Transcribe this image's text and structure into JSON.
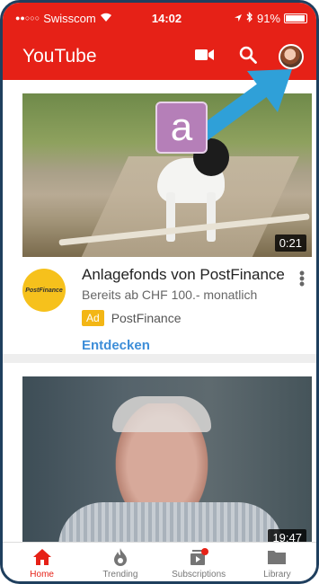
{
  "status_bar": {
    "carrier": "Swisscom",
    "time": "14:02",
    "battery": "91%"
  },
  "app_bar": {
    "title": "YouTube",
    "actions": [
      {
        "name": "camera-icon"
      },
      {
        "name": "search-icon"
      },
      {
        "name": "avatar"
      }
    ]
  },
  "overlay": {
    "badge_letter": "a"
  },
  "feed": {
    "ad_card": {
      "duration": "0:21",
      "logo_text": "PostFinance",
      "title": "Anlagefonds von PostFinance",
      "subtitle": "Bereits ab CHF 100.- monatlich",
      "ad_tag": "Ad",
      "company": "PostFinance",
      "cta": "Entdecken"
    },
    "video_card": {
      "duration": "19:47"
    }
  },
  "bottom_nav": {
    "items": [
      {
        "label": "Home",
        "icon": "home-icon",
        "active": true
      },
      {
        "label": "Trending",
        "icon": "flame-icon",
        "active": false
      },
      {
        "label": "Subscriptions",
        "icon": "subscriptions-icon",
        "active": false
      },
      {
        "label": "Library",
        "icon": "folder-icon",
        "active": false
      }
    ]
  },
  "colors": {
    "brand_red": "#e62117",
    "link_blue": "#3e8ed8",
    "ad_yellow": "#f3b615",
    "arrow_blue": "#2fa0d8",
    "badge_purple": "#b57fb8"
  }
}
